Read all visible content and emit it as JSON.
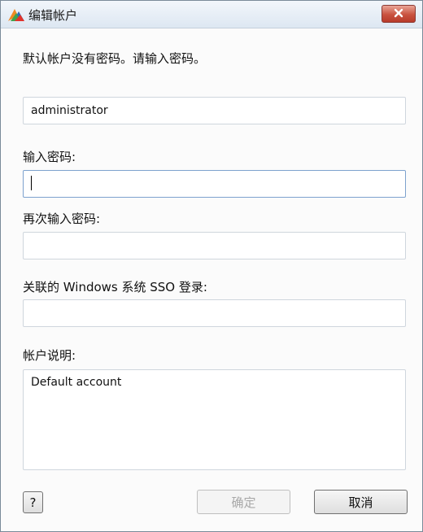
{
  "window": {
    "title": "编辑帐户",
    "close_label": "×"
  },
  "info_text": "默认帐户没有密码。请输入密码。",
  "username": {
    "value": "administrator"
  },
  "password": {
    "label": "输入密码:",
    "value": ""
  },
  "confirm_password": {
    "label": "再次输入密码:",
    "value": ""
  },
  "sso": {
    "label": "关联的 Windows 系统 SSO 登录:",
    "value": ""
  },
  "description": {
    "label": "帐户说明:",
    "value": "Default account"
  },
  "buttons": {
    "help": "?",
    "ok": "确定",
    "cancel": "取消"
  },
  "colors": {
    "accent_focus": "#7da2ce",
    "close_button": "#c9523f",
    "logo_orange": "#f08a24",
    "logo_blue": "#2b6cb8"
  }
}
